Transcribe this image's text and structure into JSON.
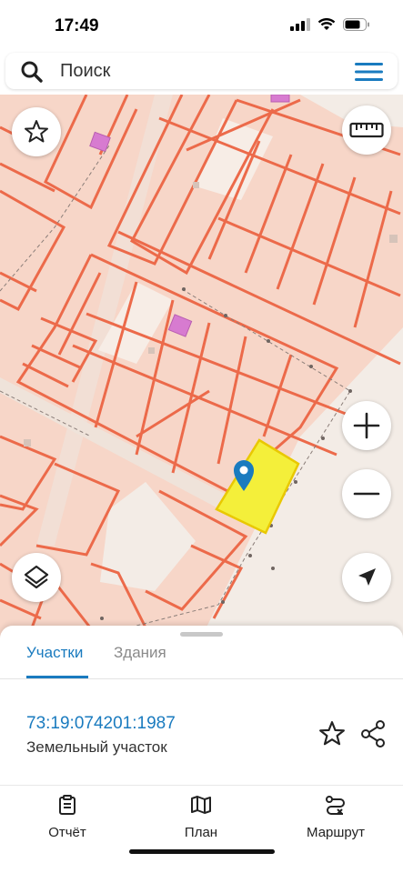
{
  "status_bar": {
    "time": "17:49"
  },
  "search": {
    "placeholder": "Поиск"
  },
  "sheet": {
    "tabs": [
      {
        "label": "Участки",
        "active": true
      },
      {
        "label": "Здания",
        "active": false
      }
    ],
    "parcel": {
      "cadastral_number": "73:19:074201:1987",
      "type": "Земельный участок"
    }
  },
  "bottom_nav": [
    {
      "label": "Отчёт",
      "icon": "report-icon"
    },
    {
      "label": "План",
      "icon": "map-plan-icon"
    },
    {
      "label": "Маршрут",
      "icon": "route-icon"
    }
  ],
  "colors": {
    "accent": "#1a7bbf",
    "parcel_border": "#ec6a4a",
    "parcel_fill": "#f7d6c8",
    "selected_parcel": "#f4ef3a",
    "building": "#d77bd0"
  }
}
